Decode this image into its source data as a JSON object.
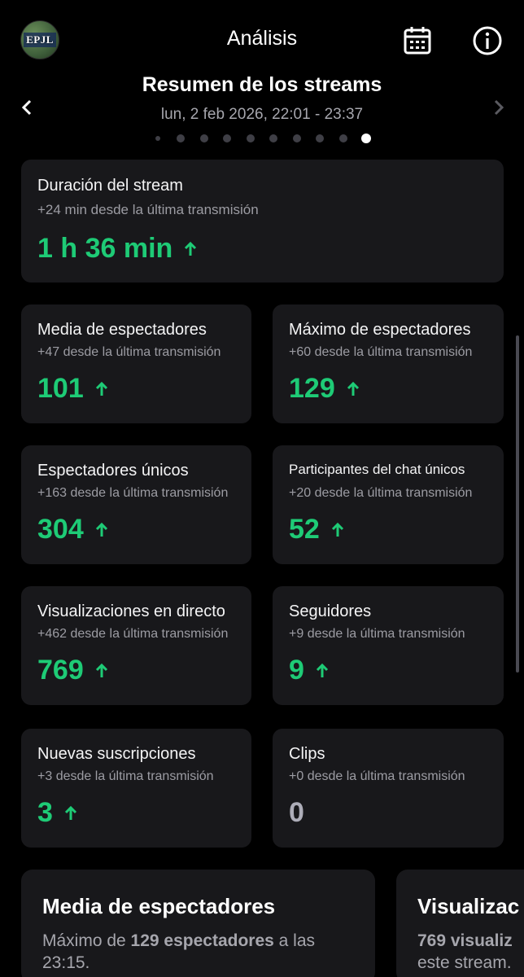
{
  "header": {
    "avatar_text": "EPJL",
    "title": "Análisis"
  },
  "period": {
    "title": "Resumen de los streams",
    "range": "lun, 2 feb 2026, 22:01 - 23:37",
    "dots_total": 10,
    "active_dot": 9
  },
  "summary": {
    "label": "Duración del stream",
    "delta": "+24 min desde la última transmisión",
    "value": "1 h 36 min",
    "trend": "up"
  },
  "stats": [
    {
      "label": "Media de espectadores",
      "delta": "+47 desde la última transmisión",
      "value": "101",
      "trend": "up"
    },
    {
      "label": "Máximo de espectadores",
      "delta": "+60 desde la última transmisión",
      "value": "129",
      "trend": "up"
    },
    {
      "label": "Espectadores únicos",
      "delta": "+163 desde la última transmisión",
      "value": "304",
      "trend": "up"
    },
    {
      "label": "Participantes del chat únicos",
      "delta": "+20 desde la última transmisión",
      "value": "52",
      "trend": "up"
    },
    {
      "label": "Visualizaciones en directo",
      "delta": "+462 desde la última transmisión",
      "value": "769",
      "trend": "up"
    },
    {
      "label": "Seguidores",
      "delta": "+9 desde la última transmisión",
      "value": "9",
      "trend": "up"
    },
    {
      "label": "Nuevas suscripciones",
      "delta": "+3 desde la última transmisión",
      "value": "3",
      "trend": "up"
    },
    {
      "label": "Clips",
      "delta": "+0 desde la última transmisión",
      "value": "0",
      "trend": "none"
    }
  ],
  "details": [
    {
      "title": "Media de espectadores",
      "text_pre": "Máximo de ",
      "text_bold": "129 espectadores",
      "text_post": " a las 23:15."
    },
    {
      "title": "Visualizac",
      "text_bold": "769 visualiz",
      "text_post": "este stream."
    }
  ],
  "colors": {
    "background": "#000000",
    "card": "#18181b",
    "positive": "#1ecb76",
    "muted_text": "#9c9ca3"
  }
}
